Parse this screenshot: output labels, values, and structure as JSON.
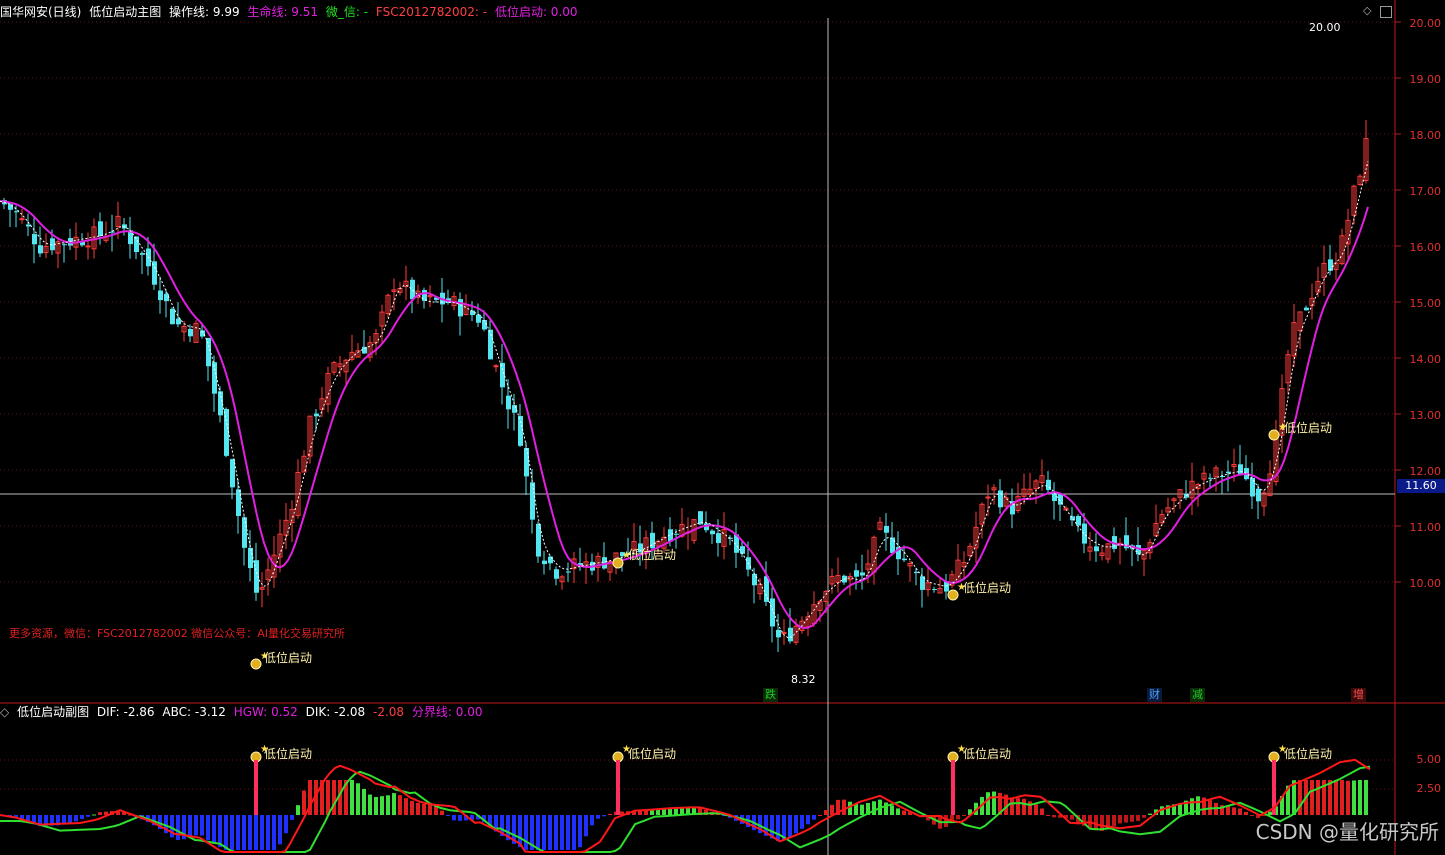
{
  "main_header": {
    "stock": "国华网安(日线)",
    "indicator": "低位启动主图",
    "op_line": "操作线: 9.99",
    "life_line": "生命线: 9.51",
    "wx_label": "微_信: -",
    "fsc": "FSC2012782002: -",
    "low_start": "低位启动: 0.00"
  },
  "sub_header": {
    "indicator": "低位启动副图",
    "dif": "DIF: -2.86",
    "abc": "ABC: -3.12",
    "hgw": "HGW: 0.52",
    "dik": "DIK: -2.08",
    "neg": "-2.08",
    "boundary": "分界线: 0.00"
  },
  "colors": {
    "up": "#ff3b3b",
    "down": "#52e6f0",
    "ma": "#e020e0",
    "axis": "#c01818",
    "grid": "#6a1010",
    "signal_text": "#fff1a8",
    "promo": "#e02020"
  },
  "y_axis_main": [
    "20.00",
    "19.00",
    "18.00",
    "17.00",
    "16.00",
    "15.00",
    "14.00",
    "13.00",
    "12.00",
    "11.00",
    "10.00"
  ],
  "y_axis_sub": [
    "5.00",
    "2.50"
  ],
  "current_price": "11.60",
  "high_label": "20.00",
  "low_label": "8.32",
  "signal_label": "低位启动",
  "promo_text": "更多资源，微信：FSC2012782002 微信公众号：AI量化交易研究所",
  "events": [
    {
      "text": "跌",
      "color": "#20d020"
    },
    {
      "text": "财",
      "color": "#4aa0ff"
    },
    {
      "text": "减",
      "color": "#20d020"
    },
    {
      "text": "增",
      "color": "#ff5050"
    }
  ],
  "watermark": "CSDN @量化研究所",
  "icons": [
    "diamond-icon",
    "restore-icon",
    "collapse-icon"
  ]
}
